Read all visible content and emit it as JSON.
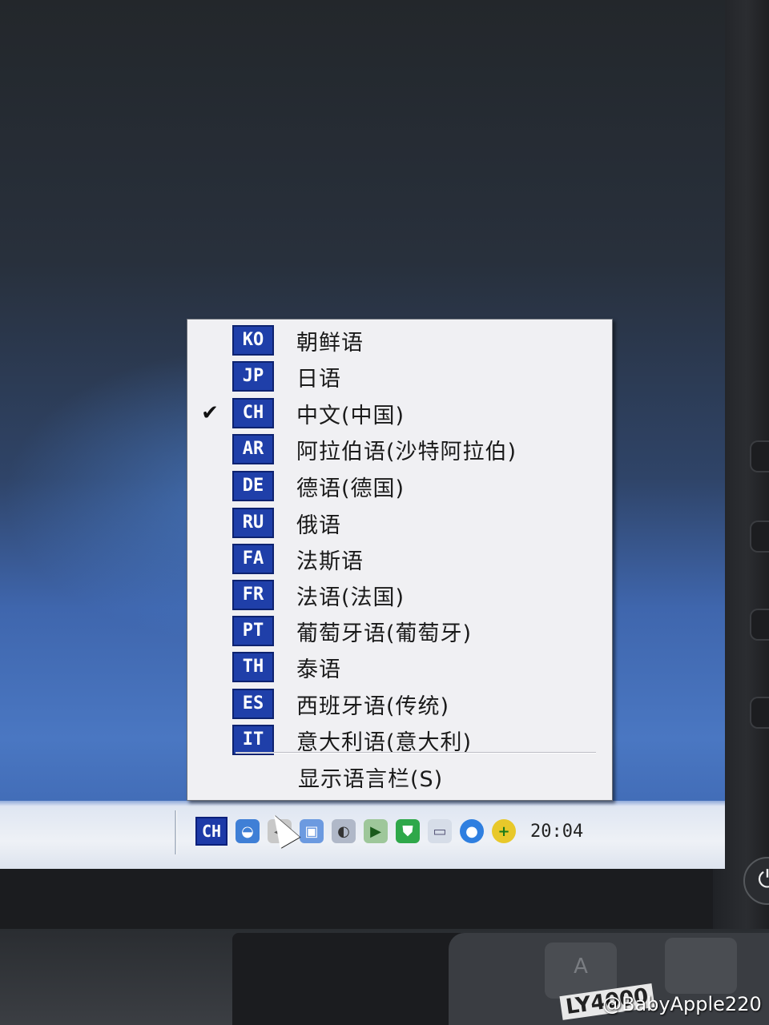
{
  "language_menu": {
    "items": [
      {
        "code": "KO",
        "label": "朝鲜语",
        "checked": false
      },
      {
        "code": "JP",
        "label": "日语",
        "checked": false
      },
      {
        "code": "CH",
        "label": "中文(中国)",
        "checked": true
      },
      {
        "code": "AR",
        "label": "阿拉伯语(沙特阿拉伯)",
        "checked": false
      },
      {
        "code": "DE",
        "label": "德语(德国)",
        "checked": false
      },
      {
        "code": "RU",
        "label": "俄语",
        "checked": false
      },
      {
        "code": "FA",
        "label": "法斯语",
        "checked": false
      },
      {
        "code": "FR",
        "label": "法语(法国)",
        "checked": false
      },
      {
        "code": "PT",
        "label": "葡萄牙语(葡萄牙)",
        "checked": false
      },
      {
        "code": "TH",
        "label": "泰语",
        "checked": false
      },
      {
        "code": "ES",
        "label": "西班牙语(传统)",
        "checked": false
      },
      {
        "code": "IT",
        "label": "意大利语(意大利)",
        "checked": false
      }
    ],
    "check_glyph": "✔",
    "show_language_bar": "显示语言栏(S)"
  },
  "taskbar": {
    "language_indicator": "CH",
    "clock": "20:04",
    "tray_icons": [
      "network-icon",
      "volume-icon",
      "network-computers-icon",
      "security-scan-icon",
      "media-icon",
      "shield-icon",
      "speech-bubble-icon",
      "update-icon",
      "add-icon"
    ]
  },
  "hardware": {
    "keyboard_brand": "LY4000",
    "key_label": "A"
  },
  "watermark": "@BabyApple220",
  "colors": {
    "code_badge": "#1f3fa9",
    "menu_bg": "#f0f0f3",
    "taskbar_bg": "#eef1f6"
  }
}
